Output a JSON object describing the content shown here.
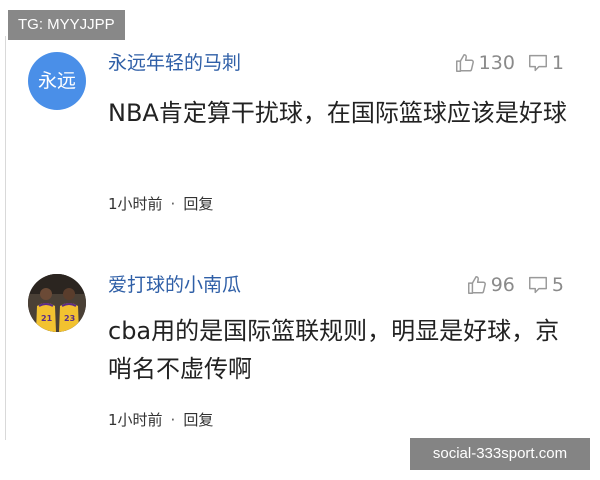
{
  "watermarks": {
    "tg": "TG: MYYJJPP",
    "site": "social-333sport.com"
  },
  "comments": [
    {
      "avatar_text": "永远",
      "avatar_color": "#4a8fe8",
      "username": "永远年轻的马刺",
      "likes": "130",
      "replies": "1",
      "text": "NBA肯定算干扰球，在国际篮球应该是好球",
      "time": "1小时前",
      "separator": "·",
      "reply_label": "回复"
    },
    {
      "avatar_text": "",
      "avatar_jerseys": [
        "21",
        "23"
      ],
      "username": "爱打球的小南瓜",
      "likes": "96",
      "replies": "5",
      "text": "cba用的是国际篮联规则，明显是好球，京哨名不虚传啊",
      "time": "1小时前",
      "separator": "·",
      "reply_label": "回复"
    }
  ],
  "icons": {
    "like": "thumbs-up-icon",
    "reply": "comment-bubble-icon"
  },
  "colors": {
    "username": "#2f5fa7",
    "muted": "#8a8a8a",
    "body": "#222222",
    "avatar_bg": "#4a8fe8"
  }
}
